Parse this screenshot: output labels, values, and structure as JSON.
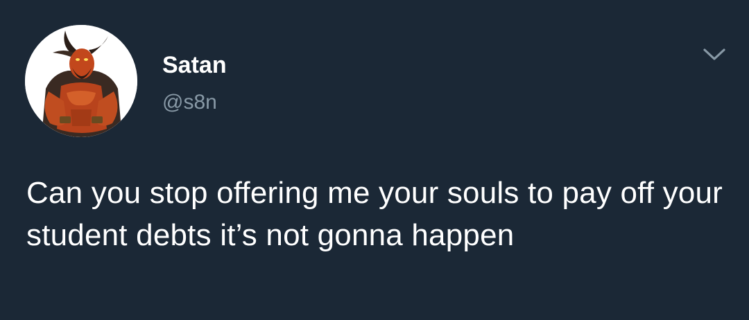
{
  "tweet": {
    "author": {
      "display_name": "Satan",
      "handle": "@s8n",
      "avatar_icon": "devil-avatar-icon"
    },
    "menu_icon": "chevron-down-icon",
    "text": "Can you stop offering me your souls to pay off your student debts it’s not gonna happen"
  },
  "colors": {
    "background": "#1b2836",
    "name": "#ffffff",
    "handle": "#8899a6",
    "text": "#ffffff"
  }
}
